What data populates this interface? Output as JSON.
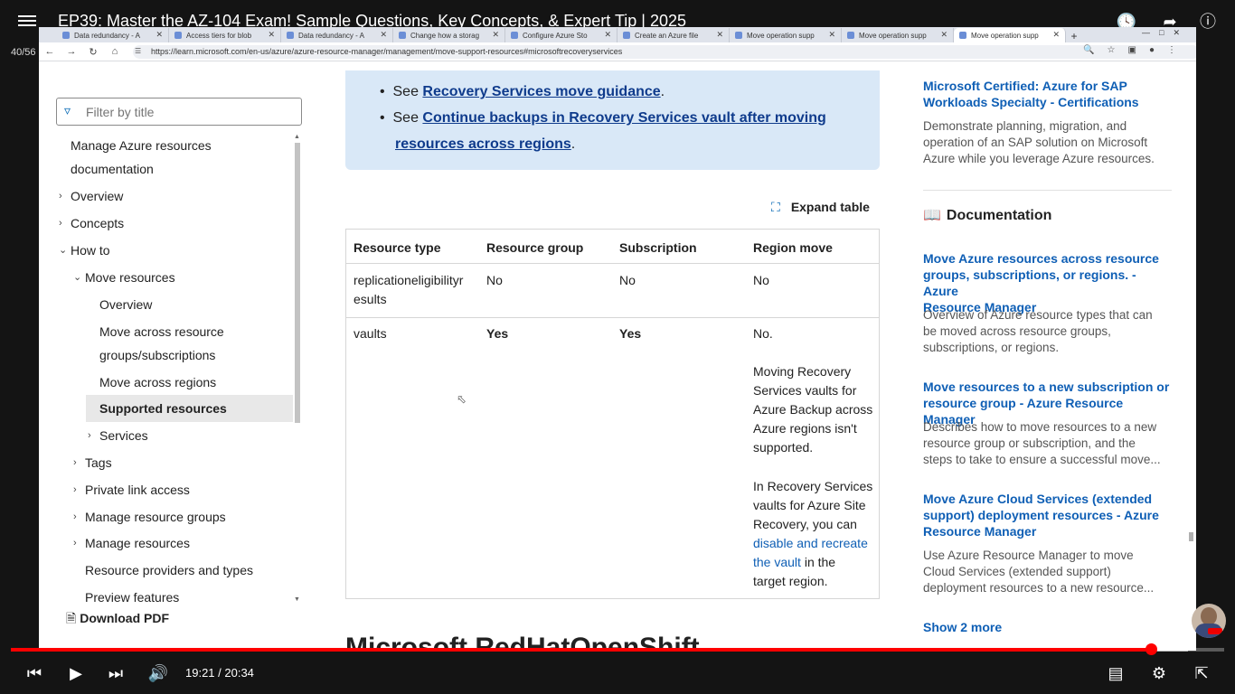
{
  "youtube": {
    "title": "EP39: Master the AZ-104 Exam! Sample Questions, Key Concepts, & Expert Tip | 2025",
    "counter": "40/56",
    "time": "19:21 / 20:34",
    "progress": 0.94,
    "buffered": 0.97
  },
  "browser": {
    "tabs": [
      {
        "label": "Data redundancy - A"
      },
      {
        "label": "Access tiers for blob"
      },
      {
        "label": "Data redundancy - A"
      },
      {
        "label": "Change how a storag"
      },
      {
        "label": "Configure Azure Sto"
      },
      {
        "label": "Create an Azure file"
      },
      {
        "label": "Move operation supp"
      },
      {
        "label": "Move operation supp"
      },
      {
        "label": "Move operation supp"
      }
    ],
    "url": "https://learn.microsoft.com/en-us/azure/azure-resource-manager/management/move-support-resources#microsoftrecoveryservices"
  },
  "sidebar": {
    "filter_placeholder": "Filter by title",
    "items": [
      {
        "label": "Manage Azure resources"
      },
      {
        "label": "documentation"
      },
      {
        "label": "Overview"
      },
      {
        "label": "Concepts"
      },
      {
        "label": "How to"
      },
      {
        "label": "Move resources"
      },
      {
        "label": "Overview"
      },
      {
        "label": "Move across resource"
      },
      {
        "label": "groups/subscriptions"
      },
      {
        "label": "Move across regions"
      },
      {
        "label": "Supported resources"
      },
      {
        "label": "Services"
      },
      {
        "label": "Tags"
      },
      {
        "label": "Private link access"
      },
      {
        "label": "Manage resource groups"
      },
      {
        "label": "Manage resources"
      },
      {
        "label": "Resource providers and types"
      },
      {
        "label": "Preview features"
      }
    ],
    "download_pdf": "Download PDF"
  },
  "main": {
    "note": {
      "see": "See",
      "link1": "Recovery Services move guidance",
      "link2a": "Continue backups in Recovery Services vault after moving",
      "link2b": "resources across regions",
      "period": "."
    },
    "expand_table": "Expand table",
    "table": {
      "headers": [
        "Resource type",
        "Resource group",
        "Subscription",
        "Region move"
      ],
      "row1": {
        "type_a": "replicationeligibilityr",
        "type_b": "esults",
        "rg": "No",
        "sub": "No",
        "region": "No"
      },
      "row2": {
        "type": "vaults",
        "rg": "Yes",
        "sub": "Yes",
        "region": "No.",
        "p1": [
          "Moving Recovery",
          "Services vaults for",
          "Azure Backup across",
          "Azure regions isn't",
          "supported."
        ],
        "p2": [
          "In Recovery Services",
          "vaults for Azure Site",
          "Recovery, you can"
        ],
        "p2_link_a": "disable and recreate",
        "p2_link_b": "the vault",
        "p2_rest_a": " in the",
        "p2_rest_b": "target region."
      }
    },
    "next_heading": "Microsoft.RedHatOpenShift"
  },
  "rail": {
    "cert_link": [
      "Microsoft Certified: Azure for SAP",
      "Workloads Specialty - Certifications"
    ],
    "cert_desc": [
      "Demonstrate planning, migration, and",
      "operation of an SAP solution on Microsoft",
      "Azure while you leverage Azure resources."
    ],
    "documentation": "Documentation",
    "doc1_link": [
      "Move Azure resources across resource",
      "groups, subscriptions, or regions. - Azure",
      "Resource Manager"
    ],
    "doc1_desc": [
      "Overview of Azure resource types that can",
      "be moved across resource groups,",
      "subscriptions, or regions."
    ],
    "doc2_link": [
      "Move resources to a new subscription or",
      "resource group - Azure Resource Manager"
    ],
    "doc2_desc": [
      "Describes how to move resources to a new",
      "resource group or subscription, and the",
      "steps to take to ensure a successful move..."
    ],
    "doc3_link": [
      "Move Azure Cloud Services (extended",
      "support) deployment resources - Azure",
      "Resource Manager"
    ],
    "doc3_desc": [
      "Use Azure Resource Manager to move",
      "Cloud Services (extended support)",
      "deployment resources to a new resource..."
    ],
    "show_more": "Show 2 more"
  },
  "colors": {
    "accent": "#0f5fb5",
    "progress": "#ff0000",
    "note_bg": "#d9e8f7"
  }
}
